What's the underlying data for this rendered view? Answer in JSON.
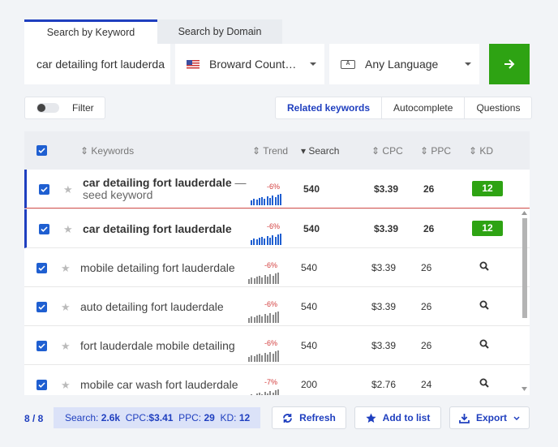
{
  "tabs": {
    "keyword": "Search by Keyword",
    "domain": "Search by Domain"
  },
  "search": {
    "keyword_value": "car detailing fort lauderda",
    "location": "Broward Count…",
    "language": "Any Language"
  },
  "filter": {
    "label": "Filter"
  },
  "modes": {
    "related": "Related keywords",
    "autocomplete": "Autocomplete",
    "questions": "Questions"
  },
  "columns": {
    "keywords": "Keywords",
    "trend": "Trend",
    "search": "Search",
    "cpc": "CPC",
    "ppc": "PPC",
    "kd": "KD"
  },
  "rows": [
    {
      "keyword": "car detailing fort lauderdale",
      "seed_suffix": " —",
      "seed_label": "seed keyword",
      "trend": "-6%",
      "search": "540",
      "cpc": "$3.39",
      "ppc": "26",
      "kd": "12"
    },
    {
      "keyword": "car detailing fort lauderdale",
      "trend": "-6%",
      "search": "540",
      "cpc": "$3.39",
      "ppc": "26",
      "kd": "12"
    },
    {
      "keyword": "mobile detailing fort lauderdale",
      "trend": "-6%",
      "search": "540",
      "cpc": "$3.39",
      "ppc": "26"
    },
    {
      "keyword": "auto detailing fort lauderdale",
      "trend": "-6%",
      "search": "540",
      "cpc": "$3.39",
      "ppc": "26"
    },
    {
      "keyword": "fort lauderdale mobile detailing",
      "trend": "-6%",
      "search": "540",
      "cpc": "$3.39",
      "ppc": "26"
    },
    {
      "keyword": "mobile car wash fort lauderdale",
      "trend": "-7%",
      "search": "200",
      "cpc": "$2.76",
      "ppc": "24"
    }
  ],
  "footer": {
    "count": "8 / 8",
    "summary_search_label": "Search:",
    "summary_search": "2.6k",
    "summary_cpc_label": "CPC:",
    "summary_cpc": "$3.41",
    "summary_ppc_label": "PPC:",
    "summary_ppc": "29",
    "summary_kd_label": "KD:",
    "summary_kd": "12",
    "refresh": "Refresh",
    "add_to_list": "Add to list",
    "export": "Export"
  },
  "colors": {
    "accent": "#1f3fbf",
    "green": "#2ea313",
    "trend_negative": "#d23c3c"
  }
}
